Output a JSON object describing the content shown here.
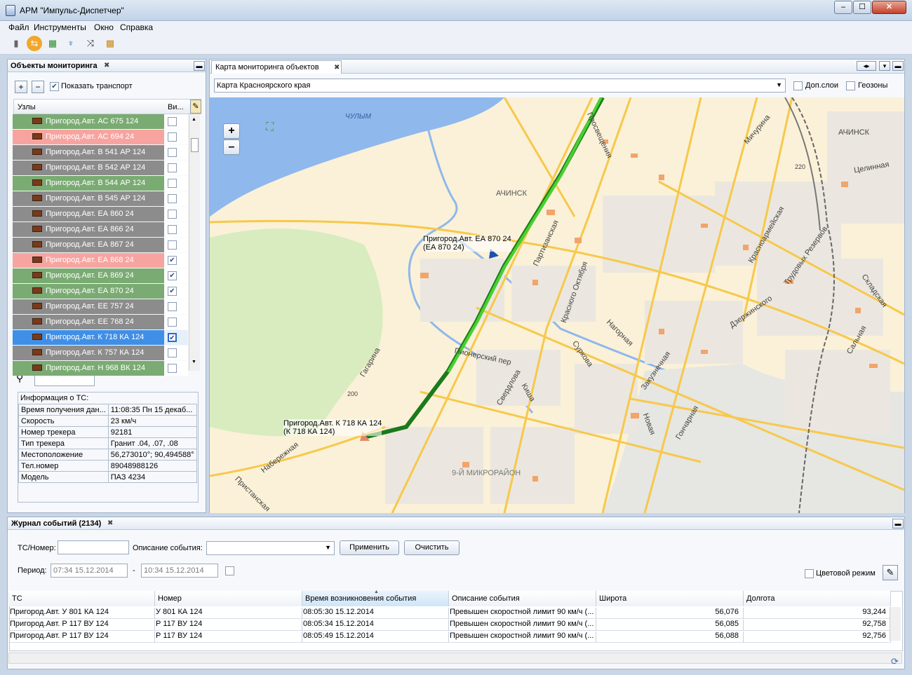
{
  "window": {
    "title": "АРМ \"Импульс-Диспетчер\""
  },
  "menu": [
    "Файл",
    "Инструменты",
    "Окно",
    "Справка"
  ],
  "toolbar": {
    "icons": [
      "document-icon",
      "refresh-icon",
      "calendar-icon",
      "antenna-icon",
      "route-icon",
      "map-icon"
    ]
  },
  "monitoring_panel": {
    "tab_label": "Объекты мониторинга",
    "show_transport_label": "Показать транспорт",
    "show_transport_checked": true,
    "col_nodes": "Узлы",
    "col_visible": "Ви...",
    "rows": [
      {
        "label": "Пригород.Авт. АС 675 124",
        "status": "green",
        "checked": false
      },
      {
        "label": "Пригород.Авт. АС 694 24",
        "status": "red",
        "checked": false
      },
      {
        "label": "Пригород.Авт. В 541 АР 124",
        "status": "gray",
        "checked": false
      },
      {
        "label": "Пригород.Авт. В 542 АР 124",
        "status": "gray",
        "checked": false
      },
      {
        "label": "Пригород.Авт. В 544 АР 124",
        "status": "green",
        "checked": false
      },
      {
        "label": "Пригород.Авт. В 545 АР 124",
        "status": "gray",
        "checked": false
      },
      {
        "label": "Пригород.Авт. ЕА 860 24",
        "status": "gray",
        "checked": false
      },
      {
        "label": "Пригород.Авт. ЕА 866 24",
        "status": "gray",
        "checked": false
      },
      {
        "label": "Пригород.Авт. ЕА 867 24",
        "status": "gray",
        "checked": false
      },
      {
        "label": "Пригород.Авт. ЕА 868 24",
        "status": "red",
        "checked": true
      },
      {
        "label": "Пригород.Авт. ЕА 869 24",
        "status": "green",
        "checked": true
      },
      {
        "label": "Пригород.Авт. ЕА 870 24",
        "status": "green",
        "checked": true
      },
      {
        "label": "Пригород.Авт. ЕЕ 757 24",
        "status": "gray",
        "checked": false
      },
      {
        "label": "Пригород.Авт. ЕЕ 768 24",
        "status": "gray",
        "checked": false
      },
      {
        "label": "Пригород.Авт. К 718 КА 124",
        "status": "selected",
        "checked": true
      },
      {
        "label": "Пригород.Авт. К 757 КА 124",
        "status": "gray",
        "checked": false
      },
      {
        "label": "Пригород.Авт. Н 968 ВК 124",
        "status": "green",
        "checked": false
      }
    ],
    "search_value": "",
    "info_title": "Информация о ТС:",
    "info": [
      [
        "Время получения дан...",
        "11:08:35 Пн 15 декаб..."
      ],
      [
        "Скорость",
        "23 км/ч"
      ],
      [
        "Номер трекера",
        "92181"
      ],
      [
        "Тип трекера",
        "Гранит .04, .07, .08"
      ],
      [
        "Местоположение",
        "56,273010°; 90,494588°"
      ],
      [
        "Тел.номер",
        "89048988126"
      ],
      [
        "Модель",
        "ПАЗ 4234"
      ]
    ]
  },
  "map_panel": {
    "tab_label": "Карта мониторинга объектов",
    "map_select": "Карта Красноярского края",
    "layers_label": "Доп.слои",
    "geozones_label": "Геозоны",
    "zoom_in": "+",
    "zoom_out": "–",
    "vehicle1_name": "Пригород.Авт. ЕА 870 24",
    "vehicle1_plate": "(ЕА 870 24)",
    "vehicle2_name": "Пригород.Авт. К 718 КА 124",
    "vehicle2_plate": "(К 718 КА 124)",
    "labels": {
      "river": "ЧУЛЫМ",
      "city": "АЧИНСК",
      "city2": "АЧИНСК",
      "district": "9-Й МИКРОРАЙОН",
      "street_pioneer": "Пионерский пер",
      "street_oktyabrya": "Красного Октября",
      "street_partizanskaya": "Партизанская",
      "street_sverdlova": "Свердлова",
      "street_kisha": "Киша",
      "street_surkova": "Суркова",
      "street_nagornaya": "Нагорная",
      "street_naberezhnaya": "Набережная",
      "street_gagarina": "Гагарина",
      "street_pristanskaya": "Пристанская",
      "street_prosvescheniya": "Просвещения",
      "street_dzerzhinskogo": "Дзержинского",
      "street_michurina": "Мичурина",
      "street_tselinnaya": "Целинная",
      "street_trudovye": "Трудовых Резервов",
      "street_krasnoarm": "Красноармейская",
      "street_skladskaya": "Складская",
      "street_salnaya": "Сальная",
      "street_goncharnaya": "Гончарная",
      "street_novaya": "Новая",
      "street_zakusnechnaya": "Закузнечная",
      "road220": "220",
      "road200": "200"
    }
  },
  "journal": {
    "tab_label": "Журнал событий (2134)",
    "ts_label": "ТС/Номер:",
    "ts_value": "",
    "desc_label": "Описание события:",
    "desc_value": "",
    "apply_label": "Применить",
    "clear_label": "Очистить",
    "period_label": "Период:",
    "period_from": "07:34 15.12.2014",
    "period_sep": "-",
    "period_to": "10:34 15.12.2014",
    "color_mode_label": "Цветовой режим",
    "columns": [
      "ТС",
      "Номер",
      "Время возникновения события",
      "Описание события",
      "Широта",
      "Долгота"
    ],
    "rows": [
      [
        "Пригород.Авт. У 801 КА 124",
        "У 801 КА 124",
        "08:05:30 15.12.2014",
        "Превышен скоростной лимит 90 км/ч (...",
        "56,076",
        "93,244"
      ],
      [
        "Пригород.Авт. Р 117 ВУ 124",
        "Р 117 ВУ 124",
        "08:05:34 15.12.2014",
        "Превышен скоростной лимит 90 км/ч (...",
        "56,085",
        "92,758"
      ],
      [
        "Пригород.Авт. Р 117 ВУ 124",
        "Р 117 ВУ 124",
        "08:05:49 15.12.2014",
        "Превышен скоростной лимит 90 км/ч (...",
        "56,088",
        "92,756"
      ]
    ]
  },
  "colors": {
    "green": "#7aab72",
    "red": "#f7a4a0",
    "gray": "#8c8c8c",
    "selected": "#3f8fe6",
    "map_bg": "#faf1d8",
    "river": "#8fb8ec",
    "road": "#f7c84a",
    "route": "#2eae1f"
  }
}
